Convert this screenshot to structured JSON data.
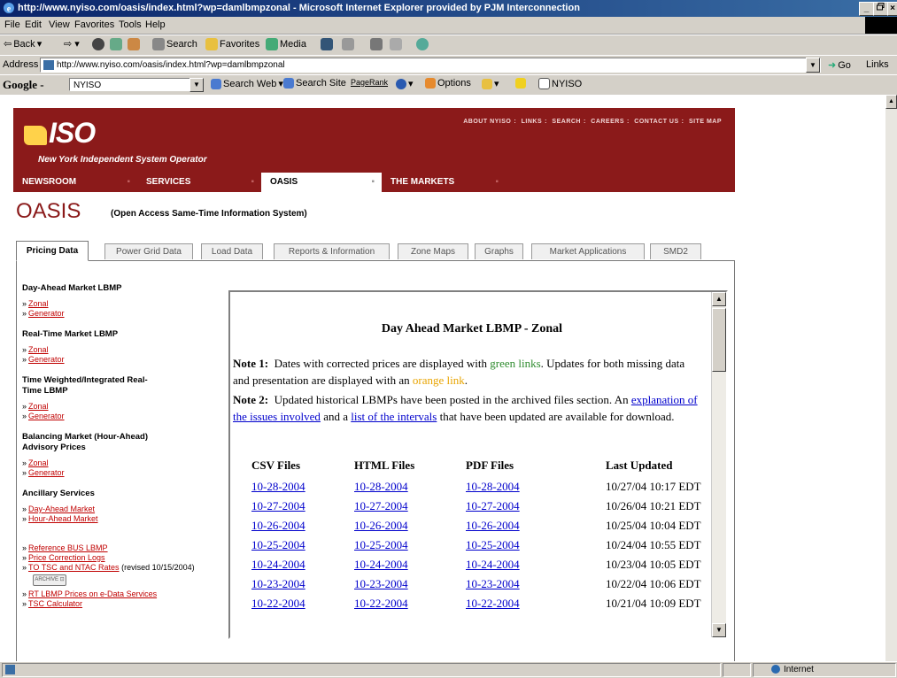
{
  "window": {
    "title": "http://www.nyiso.com/oasis/index.html?wp=damlbmpzonal - Microsoft Internet Explorer provided by PJM Interconnection",
    "minimize": "_",
    "maximize": "×"
  },
  "menu": [
    "File",
    "Edit",
    "View",
    "Favorites",
    "Tools",
    "Help"
  ],
  "toolbar": {
    "back": "Back",
    "search": "Search",
    "favorites": "Favorites",
    "media": "Media"
  },
  "address": {
    "label": "Address",
    "url": "http://www.nyiso.com/oasis/index.html?wp=damlbmpzonal",
    "go": "Go",
    "links": "Links"
  },
  "google": {
    "logo": "Google -",
    "query": "NYISO",
    "search_web": "Search Web",
    "search_site": "Search Site",
    "pagerank": "PageRank",
    "options": "Options",
    "nyiso_btn": "NYISO"
  },
  "site": {
    "logo": "ISO",
    "tagline": "New York Independent System Operator",
    "top_links": [
      "ABOUT NYISO",
      "LINKS",
      "SEARCH",
      "CAREERS",
      "CONTACT US",
      "SITE MAP"
    ],
    "nav": [
      "NEWSROOM",
      "SERVICES",
      "OASIS",
      "THE MARKETS"
    ],
    "nav_active": "OASIS"
  },
  "page": {
    "title": "OASIS",
    "subtitle": "(Open Access Same-Time Information System)"
  },
  "tabs": [
    "Pricing Data",
    "Power Grid Data",
    "Load Data",
    "Reports & Information",
    "Zone Maps",
    "Graphs",
    "Market Applications",
    "SMD2"
  ],
  "active_tab": "Pricing Data",
  "leftnav": {
    "dam": {
      "title": "Day-Ahead Market LBMP",
      "links": [
        "Zonal",
        "Generator"
      ]
    },
    "rt": {
      "title": "Real-Time Market LBMP",
      "links": [
        "Zonal",
        "Generator"
      ]
    },
    "twi": {
      "title": "Time Weighted/Integrated Real-Time LBMP",
      "links": [
        "Zonal",
        "Generator"
      ]
    },
    "bal": {
      "title": "Balancing Market (Hour-Ahead) Advisory Prices",
      "links": [
        "Zonal",
        "Generator"
      ]
    },
    "anc": {
      "title": "Ancillary Services",
      "links": [
        "Day-Ahead Market",
        "Hour-Ahead Market"
      ]
    },
    "misc": {
      "ref_bus": "Reference BUS LBMP",
      "price_corr": "Price Correction Logs",
      "tsc": "TO TSC and NTAC Rates",
      "tsc_note": "(revised 10/15/2004)",
      "archive": "ARCHIVE",
      "rt_edata": "RT LBMP Prices on e-Data Services",
      "tsc_calc": "TSC Calculator"
    }
  },
  "content": {
    "title": "Day Ahead Market LBMP - Zonal",
    "note1_label": "Note 1:",
    "note1_a": "Dates with corrected prices are displayed with",
    "note1_green": "green links",
    "note1_b": ". Updates for both missing data and presentation are displayed with an",
    "note1_orange": "orange link",
    "note1_c": ".",
    "note2_label": "Note 2:",
    "note2_a": "Updated historical LBMPs have been posted in the archived files section. An",
    "note2_link1": "explanation of the issues involved",
    "note2_b": "and a",
    "note2_link2": "list of the intervals",
    "note2_c": "that have been updated are available for download.",
    "columns": [
      "CSV Files",
      "HTML Files",
      "PDF Files",
      "Last Updated"
    ],
    "rows": [
      [
        "10-28-2004",
        "10-28-2004",
        "10-28-2004",
        "10/27/04 10:17 EDT"
      ],
      [
        "10-27-2004",
        "10-27-2004",
        "10-27-2004",
        "10/26/04 10:21 EDT"
      ],
      [
        "10-26-2004",
        "10-26-2004",
        "10-26-2004",
        "10/25/04 10:04 EDT"
      ],
      [
        "10-25-2004",
        "10-25-2004",
        "10-25-2004",
        "10/24/04 10:55 EDT"
      ],
      [
        "10-24-2004",
        "10-24-2004",
        "10-24-2004",
        "10/23/04 10:05 EDT"
      ],
      [
        "10-23-2004",
        "10-23-2004",
        "10-23-2004",
        "10/22/04 10:06 EDT"
      ],
      [
        "10-22-2004",
        "10-22-2004",
        "10-22-2004",
        "10/21/04 10:09 EDT"
      ]
    ]
  },
  "status": {
    "zone": "Internet"
  },
  "colors": {
    "brand_red": "#8b1a1a",
    "link_red": "#c00000",
    "link_blue": "#0000cc"
  }
}
